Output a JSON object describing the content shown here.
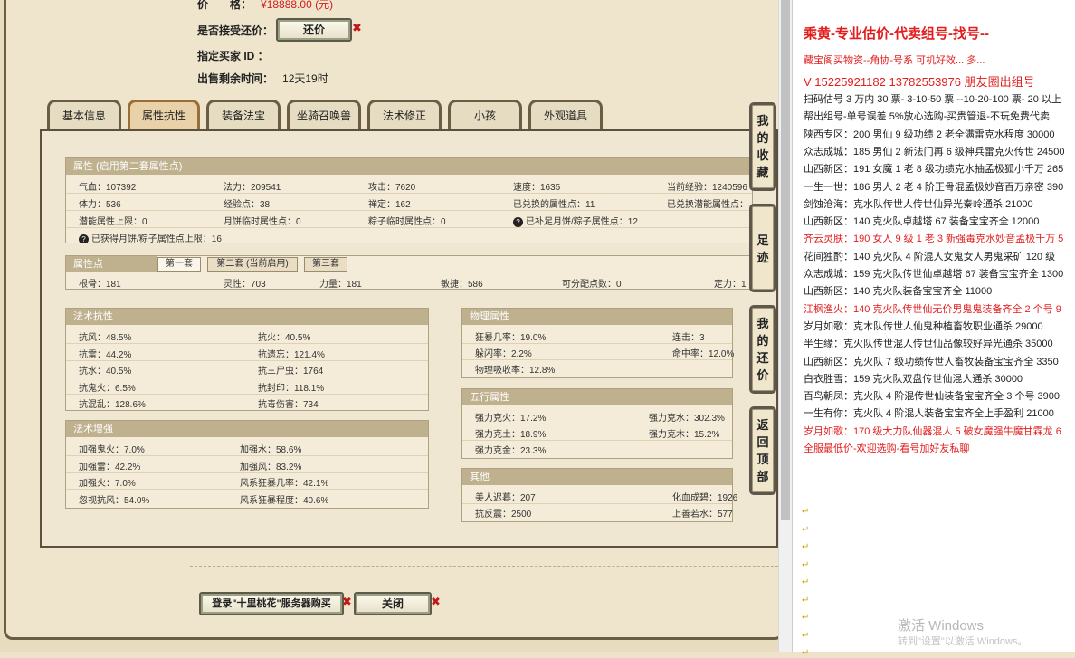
{
  "trade": {
    "price_label": "价　　格：",
    "price_value": "¥18888.00 (元)",
    "counter_label": "是否接受还价：",
    "counter_button": "还价",
    "buyer_label": "指定买家 ID ：",
    "time_label": "出售剩余时间：",
    "time_value": "12天19时"
  },
  "tabs": [
    "基本信息",
    "属性抗性",
    "装备法宝",
    "坐骑召唤兽",
    "法术修正",
    "小孩",
    "外观道具"
  ],
  "attr": {
    "header": "属性 (启用第二套属性点)",
    "r1": [
      "气血：107392",
      "法力：209541",
      "攻击：7620",
      "速度：1635",
      "当前经验：1240596"
    ],
    "r2": [
      "体力：536",
      "经验点：38",
      "禅定：162",
      "已兑换的属性点：11",
      "已兑换潜能属性点："
    ],
    "r3": [
      "潜能属性上限：0",
      "月饼临时属性点：0",
      "粽子临时属性点：0",
      "已补足月饼/粽子属性点：12"
    ],
    "r4": "已获得月饼/粽子属性点上限：16"
  },
  "points": {
    "header": "属性点",
    "subtabs": [
      "第一套",
      "第二套 (当前启用)",
      "第三套"
    ],
    "row": [
      "根骨：181",
      "灵性：703",
      "力量：181",
      "敏捷：586",
      "可分配点数：0",
      "定力：1"
    ]
  },
  "resist": {
    "header": "法术抗性",
    "rows": [
      [
        "抗风：48.5%",
        "抗火：40.5%"
      ],
      [
        "抗雷：44.2%",
        "抗遗忘：121.4%"
      ],
      [
        "抗水：40.5%",
        "抗三尸虫：1764"
      ],
      [
        "抗鬼火：6.5%",
        "抗封印：118.1%"
      ],
      [
        "抗混乱：128.6%",
        "抗毒伤害：734"
      ]
    ]
  },
  "enhance": {
    "header": "法术增强",
    "rows": [
      [
        "加强鬼火：7.0%",
        "加强水：58.6%"
      ],
      [
        "加强雷：42.2%",
        "加强风：83.2%"
      ],
      [
        "加强火：7.0%",
        "风系狂暴几率：42.1%"
      ],
      [
        "忽视抗风：54.0%",
        "风系狂暴程度：40.6%"
      ]
    ]
  },
  "physical": {
    "header": "物理属性",
    "rows": [
      [
        "狂暴几率：19.0%",
        "连击：3"
      ],
      [
        "躲闪率：2.2%",
        "命中率：12.0%"
      ],
      [
        "物理吸收率：12.8%",
        ""
      ]
    ]
  },
  "elements": {
    "header": "五行属性",
    "rows": [
      [
        "强力克火：17.2%",
        "强力克水：302.3%"
      ],
      [
        "强力克土：18.9%",
        "强力克木：15.2%"
      ],
      [
        "强力克金：23.3%",
        ""
      ]
    ]
  },
  "other": {
    "header": "其他",
    "rows": [
      [
        "美人迟暮：207",
        "化血成碧：1926"
      ],
      [
        "抗反震：2500",
        "上善若水：577"
      ]
    ]
  },
  "bottom": {
    "buy_button": "登录\"十里桃花\"服务器购买",
    "close_button": "关闭"
  },
  "side": {
    "fav": "我的收藏",
    "footprint": "足迹",
    "myoffer": "我的还价",
    "top": "返回顶部"
  },
  "right_panel": {
    "lines": [
      {
        "t": "乘黄-专业估价-代卖组号-找号--",
        "c": "red",
        "big": true
      },
      {
        "t": "藏宝阁买物资--角协-号系 可机好效... 多...",
        "c": "red"
      },
      {
        "t": "V 15225921182   13782553976 朋友圈出组号",
        "c": "red",
        "mid": true
      },
      {
        "t": "扫码估号 3 万内 30 票- 3-10-50 票 --10-20-100 票- 20 以上",
        "c": ""
      },
      {
        "t": "帮出组号-单号误差 5%放心选购-买贵管退-不玩免费代卖",
        "c": ""
      },
      {
        "t": "陕西专区：200 男仙 9 级功绩 2 老全满雷克水程度 30000",
        "c": ""
      },
      {
        "t": "众志成城：185 男仙 2 新法门再 6 级神兵雷克火传世 24500",
        "c": ""
      },
      {
        "t": "山西新区：191 女魔 1 老 8 级功绩克水抽孟极狐小千万 265",
        "c": ""
      },
      {
        "t": "一生一世：186 男人 2 老 4 阶正骨混孟极妙音百万亲密 390",
        "c": ""
      },
      {
        "t": "剑蚀沧海：克水队传世人传世仙异光秦岭通杀 21000",
        "c": ""
      },
      {
        "t": "山西新区：140 克火队卓越塔 67 装备宝宝齐全 12000",
        "c": ""
      },
      {
        "t": "齐云灵肤：190 女人 9 级 1 老 3 新强毒克水妙音孟极千万 5",
        "c": "red"
      },
      {
        "t": "花间独酌：140 克火队 4 阶混人女鬼女人男鬼采矿 120 级",
        "c": ""
      },
      {
        "t": "众志成城：159 克火队传世仙卓越塔 67 装备宝宝齐全 1300",
        "c": ""
      },
      {
        "t": "山西新区：140 克火队装备宝宝齐全 11000",
        "c": ""
      },
      {
        "t": "江枫渔火：140 克火队传世仙无价男鬼鬼装备齐全 2 个号 9",
        "c": "red"
      },
      {
        "t": "岁月如歌：克木队传世人仙鬼种植畜牧职业通杀 29000",
        "c": ""
      },
      {
        "t": "半生缘：克火队传世混人传世仙品像较好异光通杀 35000",
        "c": ""
      },
      {
        "t": "山西新区：克火队 7 级功绩传世人畜牧装备宝宝齐全 3350",
        "c": ""
      },
      {
        "t": "白衣胜雪：159 克火队双盘传世仙混人通杀 30000",
        "c": ""
      },
      {
        "t": "百鸟朝凤：克火队 4 阶混传世仙装备宝宝齐全 3 个号 3900",
        "c": ""
      },
      {
        "t": "一生有你：克火队 4 阶混人装备宝宝齐全上手盈利 21000",
        "c": ""
      },
      {
        "t": "岁月如歌：170 级大力队仙器混人 5 破女魔强牛魔甘霖龙 6",
        "c": "red"
      },
      {
        "t": "全服最低价-欢迎选购-看号加好友私聊",
        "c": "red"
      }
    ],
    "return_mark": "↵",
    "watermark1": "激活 Windows",
    "watermark2": "转到\"设置\"以激活 Windows。"
  }
}
